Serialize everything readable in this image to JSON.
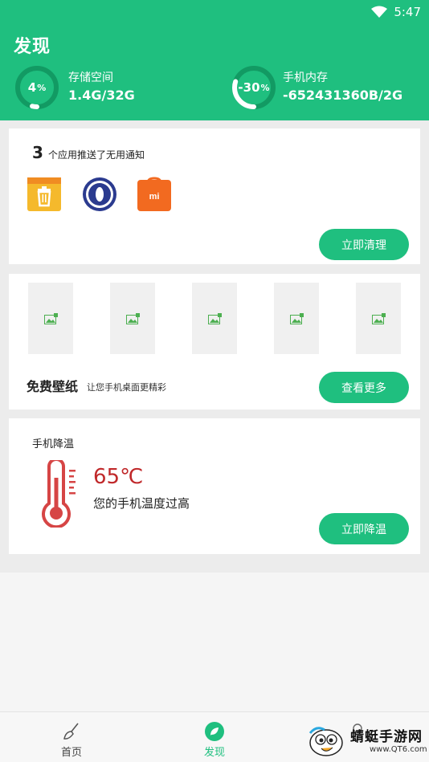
{
  "status_bar": {
    "time": "5:47",
    "icons": [
      "wifi-icon"
    ]
  },
  "header": {
    "title": "发现",
    "storage": {
      "label": "存储空间",
      "value": "1.4G/32G",
      "percent_text": "4",
      "percent_unit": "%",
      "level": 0.04
    },
    "memory": {
      "label": "手机内存",
      "value": "-652431360B/2G",
      "percent_text": "-30",
      "percent_unit": "%",
      "level": 0.3
    }
  },
  "notifications": {
    "count": "3",
    "text": "个应用推送了无用通知",
    "apps": [
      "trash-cleaner-app-icon",
      "opera-o-app-icon",
      "mi-store-app-icon"
    ],
    "button_label": "立即清理"
  },
  "wallpaper": {
    "title": "免费壁纸",
    "subtitle": "让您手机桌面更精彩",
    "thumbnail_count": 5,
    "button_label": "查看更多"
  },
  "cooling": {
    "title": "手机降温",
    "temperature": "65℃",
    "description": "您的手机温度过高",
    "button_label": "立即降温"
  },
  "bottom_nav": {
    "items": [
      {
        "label": "首页",
        "icon": "broom-icon",
        "active": false
      },
      {
        "label": "发现",
        "icon": "leaf-icon",
        "active": true
      },
      {
        "label": "",
        "icon": "profile-icon",
        "active": false
      }
    ]
  },
  "watermark": {
    "text": "蜻蜓手游网",
    "url": "www.QT6.com"
  },
  "colors": {
    "primary": "#1fbf7f",
    "danger": "#c0282a",
    "background": "#ececec"
  }
}
